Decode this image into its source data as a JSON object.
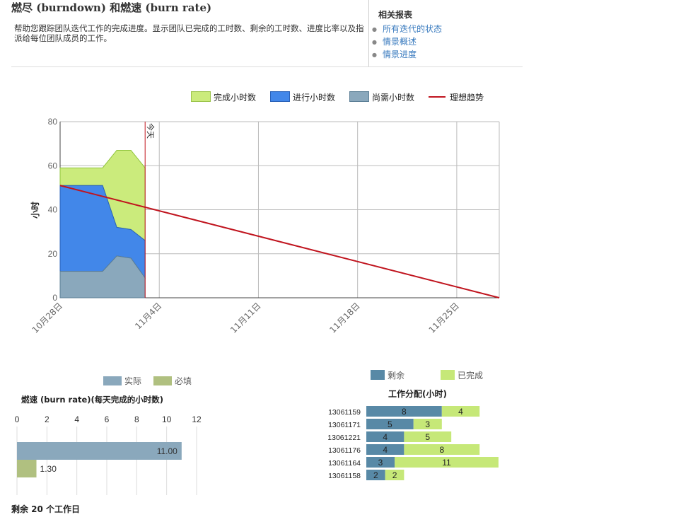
{
  "header": {
    "title": "燃尽 (burndown) 和燃速 (burn rate)",
    "description": "帮助您跟踪团队迭代工作的完成进度。显示团队已完成的工时数、剩余的工时数、进度比率以及指派给每位团队成员的工作。"
  },
  "related": {
    "title": "相关报表",
    "links": [
      "所有迭代的状态",
      "情景概述",
      "情景进度"
    ]
  },
  "burndown_legend": [
    "完成小时数",
    "进行小时数",
    "尚需小时数",
    "理想趋势"
  ],
  "burnrate_legend": [
    "实际",
    "必填"
  ],
  "work_legend": [
    "剩余",
    "已完成"
  ],
  "footer": {
    "remaining_text": "剩余 20 个工作日"
  },
  "colors": {
    "completed": "#cbeb7c",
    "in_progress": "#4287e9",
    "remaining": "#8aa8bc",
    "ideal": "#c0141e",
    "actual": "#8aa8bc",
    "required": "#b0c080",
    "work_remaining": "#5889a6",
    "work_done": "#c6e878"
  },
  "chart_data": [
    {
      "type": "area",
      "ylabel": "小时",
      "ylim": [
        0,
        80
      ],
      "yticks": [
        0,
        20,
        40,
        60,
        80
      ],
      "xlim": [
        "10月28日",
        "11月28日"
      ],
      "xticks": [
        "10月28日",
        "11月4日",
        "11月11日",
        "11月18日",
        "11月25日"
      ],
      "today_label": "今天",
      "today": "11月3日",
      "x": [
        "10月28日",
        "10月30日",
        "10月31日",
        "11月1日",
        "11月2日",
        "11月3日"
      ],
      "series": [
        {
          "name": "尚需小时数",
          "values": [
            12,
            12,
            12,
            19,
            18,
            9
          ]
        },
        {
          "name": "进行小时数",
          "values": [
            39,
            39,
            39,
            13,
            13,
            17
          ]
        },
        {
          "name": "完成小时数",
          "values": [
            8,
            8,
            8,
            35,
            36,
            33
          ]
        }
      ],
      "ideal": {
        "name": "理想趋势",
        "start": [
          "10月28日",
          51
        ],
        "end": [
          "11月28日",
          0
        ]
      },
      "grid": true,
      "legend": "top-right"
    },
    {
      "type": "bar",
      "orientation": "horizontal",
      "title": "燃速 (burn rate)(每天完成的小时数)",
      "xlim": [
        0,
        12
      ],
      "xticks": [
        0,
        2,
        4,
        6,
        8,
        10,
        12
      ],
      "series": [
        {
          "name": "实际",
          "value": 11.0,
          "label": "11.00"
        },
        {
          "name": "必填",
          "value": 1.3,
          "label": "1.30"
        }
      ],
      "legend": "top"
    },
    {
      "type": "bar",
      "orientation": "horizontal",
      "stacked": true,
      "title": "工作分配(小时)",
      "categories": [
        "13061159",
        "13061171",
        "13061221",
        "13061176",
        "13061164",
        "13061158"
      ],
      "series": [
        {
          "name": "剩余",
          "values": [
            8,
            5,
            4,
            4,
            3,
            2
          ]
        },
        {
          "name": "已完成",
          "values": [
            4,
            3,
            5,
            8,
            11,
            2
          ]
        }
      ],
      "legend": "top"
    }
  ]
}
